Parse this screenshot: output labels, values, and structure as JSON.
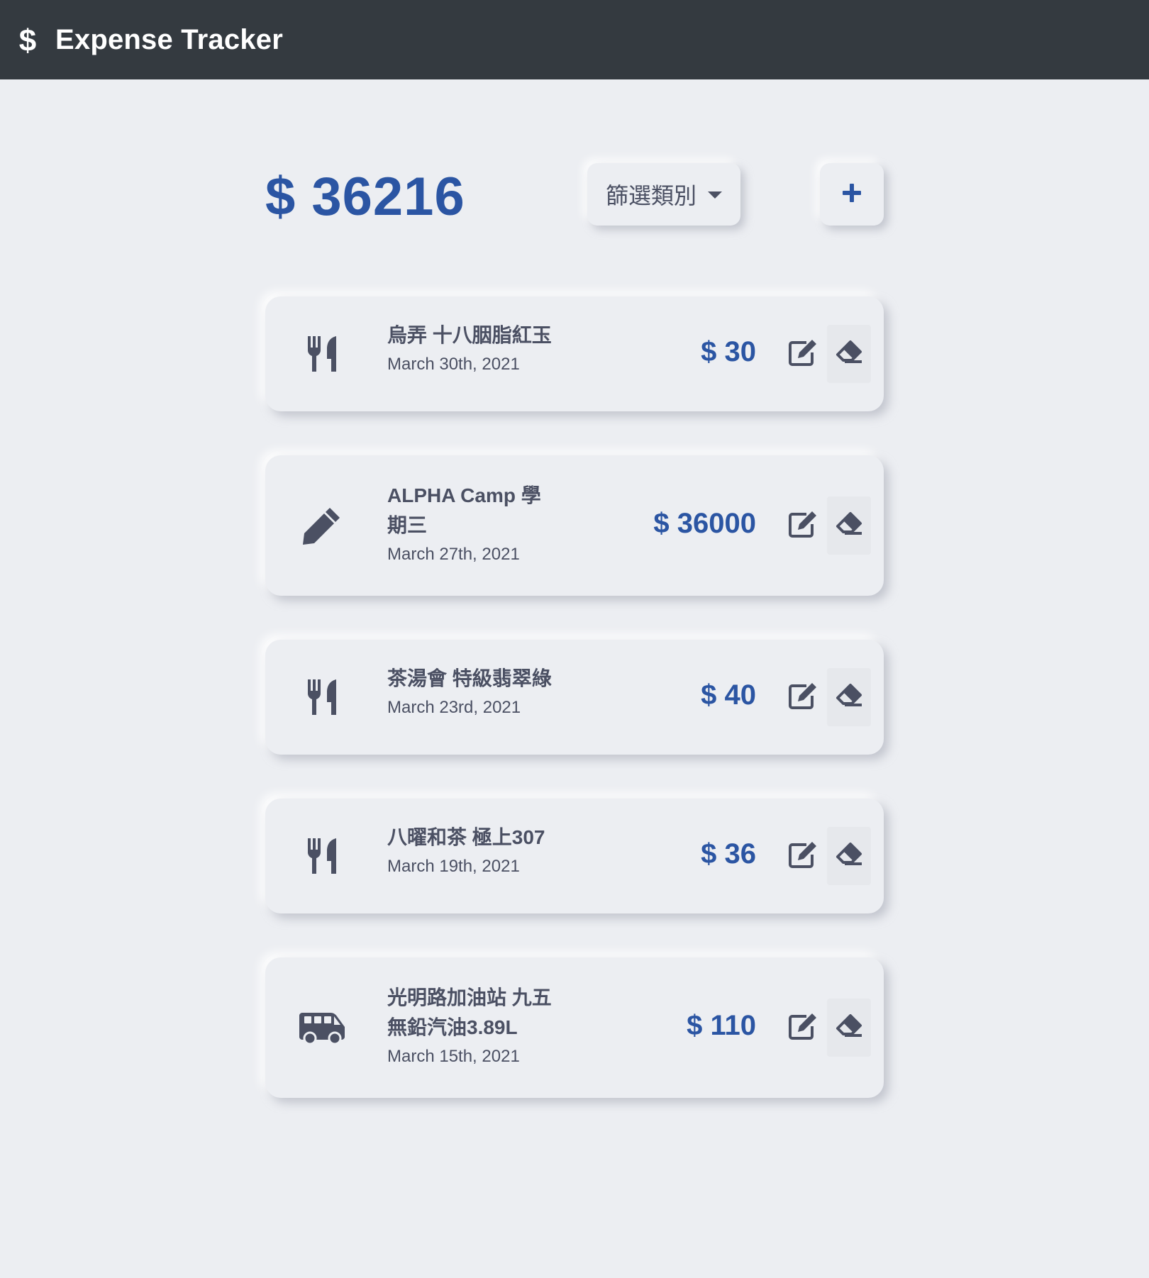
{
  "navbar": {
    "brand_icon": "dollar-sign-icon",
    "title": "Expense Tracker"
  },
  "summary": {
    "total": "$ 36216",
    "filter_label": "篩選類別",
    "add_icon": "plus-icon"
  },
  "records": [
    {
      "category_icon": "utensils-icon",
      "name": "烏弄 十八胭脂紅玉",
      "date": "March 30th, 2021",
      "amount": "$ 30"
    },
    {
      "category_icon": "pencil-icon",
      "name": "ALPHA Camp 學期三",
      "date": "March 27th, 2021",
      "amount": "$ 36000"
    },
    {
      "category_icon": "utensils-icon",
      "name": "茶湯會 特級翡翠綠",
      "date": "March 23rd, 2021",
      "amount": "$ 40"
    },
    {
      "category_icon": "utensils-icon",
      "name": "八曜和茶 極上307",
      "date": "March 19th, 2021",
      "amount": "$ 36"
    },
    {
      "category_icon": "shuttle-van-icon",
      "name": "光明路加油站 九五無鉛汽油3.89L",
      "date": "March 15th, 2021",
      "amount": "$ 110"
    }
  ],
  "colors": {
    "navbar_bg": "#343a40",
    "page_bg": "#eceef2",
    "accent_blue": "#2b55a3",
    "text_gray": "#4b5063"
  }
}
